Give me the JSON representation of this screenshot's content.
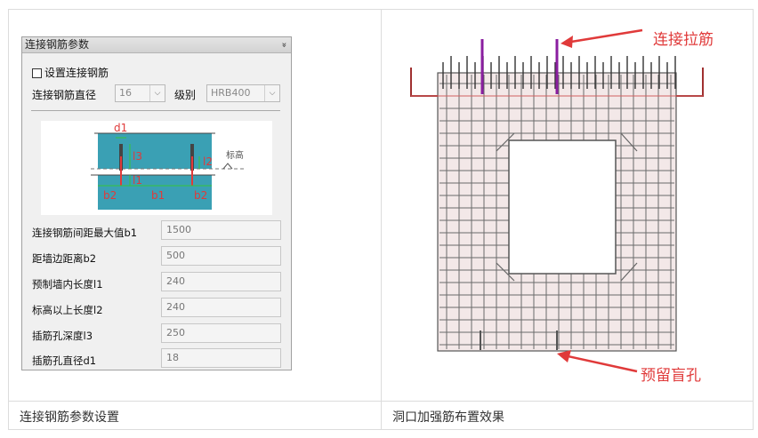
{
  "panel": {
    "title": "连接钢筋参数",
    "collapse_glyph": "»",
    "checkbox_label": "设置连接钢筋",
    "diameter_label": "连接钢筋直径",
    "diameter_value": "16",
    "grade_label": "级别",
    "grade_value": "HRB400",
    "diagram_labels": {
      "d1": "d1",
      "l3": "l3",
      "l2": "l2",
      "l1": "l1",
      "b2_left": "b2",
      "b1": "b1",
      "b2_right": "b2",
      "elevation": "标高"
    },
    "fields": [
      {
        "label": "连接钢筋间距最大值b1",
        "value": "1500"
      },
      {
        "label": "距墙边距离b2",
        "value": "500"
      },
      {
        "label": "预制墙内长度l1",
        "value": "240"
      },
      {
        "label": "标高以上长度l2",
        "value": "240"
      },
      {
        "label": "插筋孔深度l3",
        "value": "250"
      },
      {
        "label": "插筋孔直径d1",
        "value": "18"
      }
    ]
  },
  "annotations": {
    "top": "连接拉筋",
    "bottom": "预留盲孔"
  },
  "captions": {
    "left": "连接钢筋参数设置",
    "right": "洞口加强筋布置效果"
  },
  "colors": {
    "wall_fill": "#f3e8e8",
    "rebar": "#6a6a6a",
    "accent_red": "#e03a3a",
    "connector_purple": "#8a1ea0",
    "concrete_blue": "#3aa0b4",
    "dim_green": "#36c43a"
  }
}
